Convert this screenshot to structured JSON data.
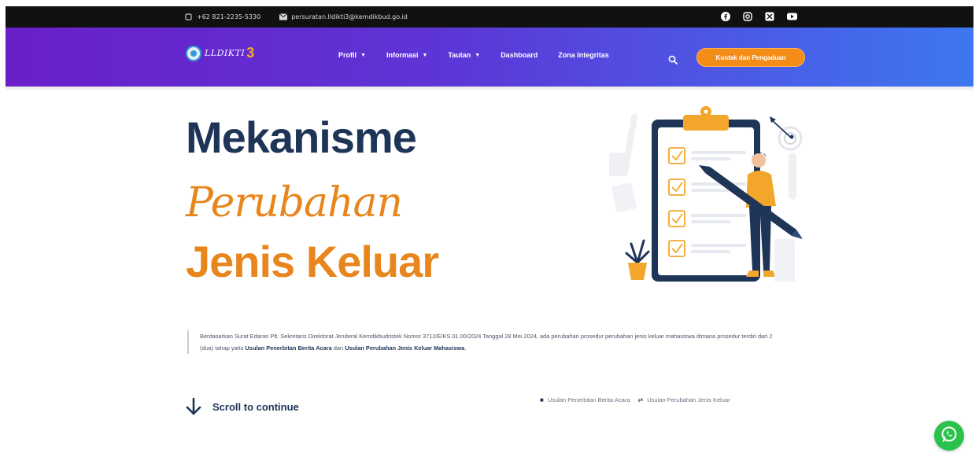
{
  "topbar": {
    "phone": "+62 821-2235-5330",
    "email": "persuratan.lldikti3@kemdikbud.go.id",
    "social_icons": [
      "facebook-icon",
      "instagram-icon",
      "twitter-icon",
      "youtube-icon"
    ]
  },
  "nav": {
    "logo_text": "LLDIKTI",
    "logo_number": "3",
    "items": [
      {
        "label": "Profil",
        "dropdown": true
      },
      {
        "label": "Informasi",
        "dropdown": true
      },
      {
        "label": "Tautan",
        "dropdown": true
      },
      {
        "label": "Dashboard",
        "dropdown": false
      },
      {
        "label": "Zona Integritas",
        "dropdown": false
      }
    ],
    "cta_label": "Kontak dan Pengaduan"
  },
  "hero": {
    "line1": "Mekanisme",
    "line2": "Perubahan",
    "line3": "Jenis Keluar"
  },
  "description": {
    "text_before": "Berdasarkan Surat Edaran Plt. Sekretaris Direktorat Jenderal Kemdikbudristek Nomor 3712/E/KS.01.00/2024 Tanggal 28 Mei 2024, ada perubahan prosedur perubahan jenis keluar mahasiswa dimana prosedur terdiri dari 2 (dua) tahap yaitu ",
    "bold1": "Usulan Penerbitan Berita Acara",
    "text_mid": " dan ",
    "bold2": "Usulan Perubahan Jenis Keluar Mahasiswa",
    "text_after": "."
  },
  "scroll_label": "Scroll to continue",
  "links": [
    {
      "label": "Usulan Penerbitan Berita Acara",
      "icon": "document-icon"
    },
    {
      "label": "Usulan Perubahan Jenis Keluar",
      "icon": "swap-icon"
    }
  ],
  "colors": {
    "navy": "#1e3558",
    "orange": "#e8861d",
    "nav_gradient_start": "#6a1fc8",
    "nav_gradient_end": "#3d77f0",
    "whatsapp": "#2bc24b"
  }
}
